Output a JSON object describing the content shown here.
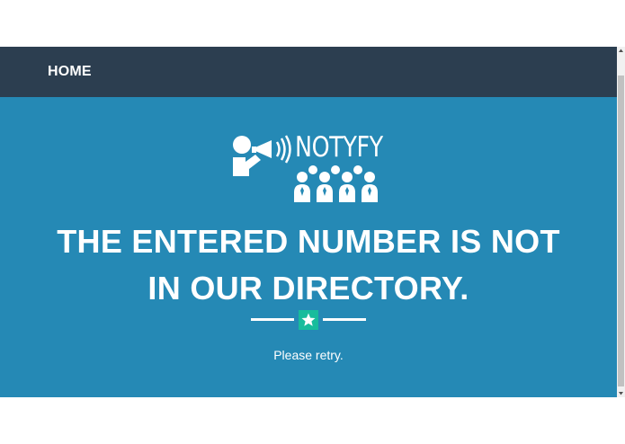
{
  "nav": {
    "home_label": "HOME"
  },
  "logo": {
    "text": "NOTYFY",
    "icon": "megaphone-audience-icon"
  },
  "hero": {
    "headline_line1": "THE ENTERED NUMBER IS NOT",
    "headline_line2": "IN OUR DIRECTORY.",
    "divider_icon": "star-icon",
    "subtitle": "Please retry."
  },
  "colors": {
    "navbar": "#2c3e50",
    "hero": "#2589b5",
    "accent": "#18bc9c",
    "text": "#ffffff"
  }
}
